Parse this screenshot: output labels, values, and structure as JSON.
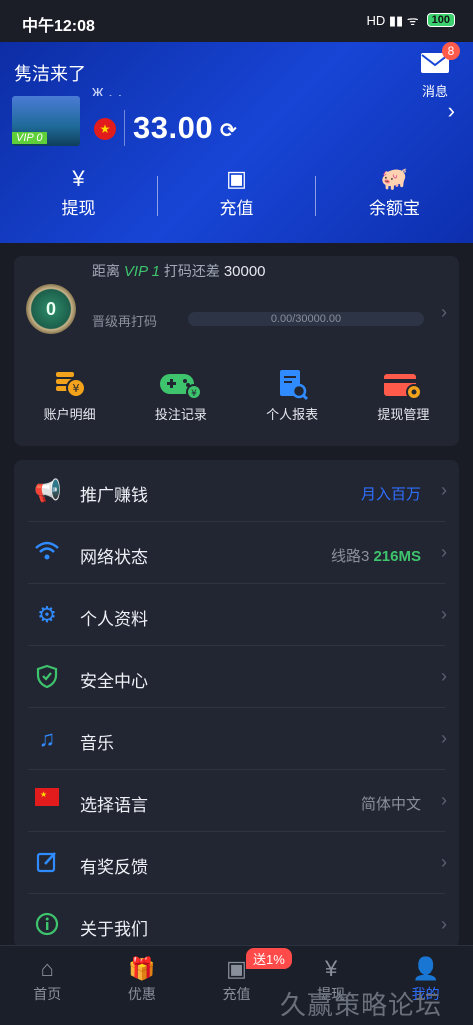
{
  "status_bar": {
    "time": "中午12:08",
    "icons": "HD ▮▮ ᯤ",
    "battery": "100"
  },
  "header": {
    "username": "隽洁来了",
    "message_label": "消息",
    "message_badge": "8",
    "avatar_vip": "VIP 0",
    "account": "ж  ,   ,",
    "country_flag": "★",
    "balance": "33.00",
    "refresh_icon": "⟳",
    "actions": [
      {
        "label": "提现",
        "icon": "¥"
      },
      {
        "label": "充值",
        "icon": "▣"
      },
      {
        "label": "余额宝",
        "icon": "🐖"
      }
    ]
  },
  "vip_card": {
    "coin_level": "0",
    "distance_prefix": "距离",
    "target_vip": "VIP 1",
    "distance_mid": "打码还差",
    "remaining": "30000",
    "upgrade_label": "晋级再打码",
    "progress_text": "0.00/30000.00",
    "progress_fraction": 0,
    "quick_links": [
      {
        "label": "账户明细",
        "icon": "coins-icon",
        "color": "#f2a21b"
      },
      {
        "label": "投注记录",
        "icon": "gamepad-icon",
        "color": "#3ec46d"
      },
      {
        "label": "个人报表",
        "icon": "report-icon",
        "color": "#2f8bff"
      },
      {
        "label": "提现管理",
        "icon": "card-gear-icon",
        "color": "#ff5a4a"
      }
    ]
  },
  "menu": [
    {
      "label": "推广赚钱",
      "right": "月入百万",
      "icon": "megaphone-icon",
      "color": "#f2a21b"
    },
    {
      "label": "网络状态",
      "right": "线路3",
      "right_extra": "216MS",
      "icon": "wifi-icon",
      "color": "#2f8bff"
    },
    {
      "label": "个人资料",
      "right": "",
      "icon": "gear-icon",
      "color": "#2f8bff"
    },
    {
      "label": "安全中心",
      "right": "",
      "icon": "shield-icon",
      "color": "#3ec46d"
    },
    {
      "label": "音乐",
      "right": "",
      "icon": "music-icon",
      "color": "#2f8bff"
    },
    {
      "label": "选择语言",
      "right": "简体中文",
      "icon": "flag-icon",
      "color": "#e21c1c"
    },
    {
      "label": "有奖反馈",
      "right": "",
      "icon": "edit-icon",
      "color": "#2f8bff"
    },
    {
      "label": "关于我们",
      "right": "",
      "icon": "info-icon",
      "color": "#3ec46d"
    }
  ],
  "tabbar": {
    "tabs": [
      {
        "label": "首页",
        "icon": "⌂"
      },
      {
        "label": "优惠",
        "icon": "🎁"
      },
      {
        "label": "充值",
        "icon": "▣"
      },
      {
        "label": "提现",
        "icon": "¥"
      },
      {
        "label": "我的",
        "icon": "👤"
      }
    ],
    "promo_badge": "送1%"
  },
  "watermark": "久赢策略论坛"
}
